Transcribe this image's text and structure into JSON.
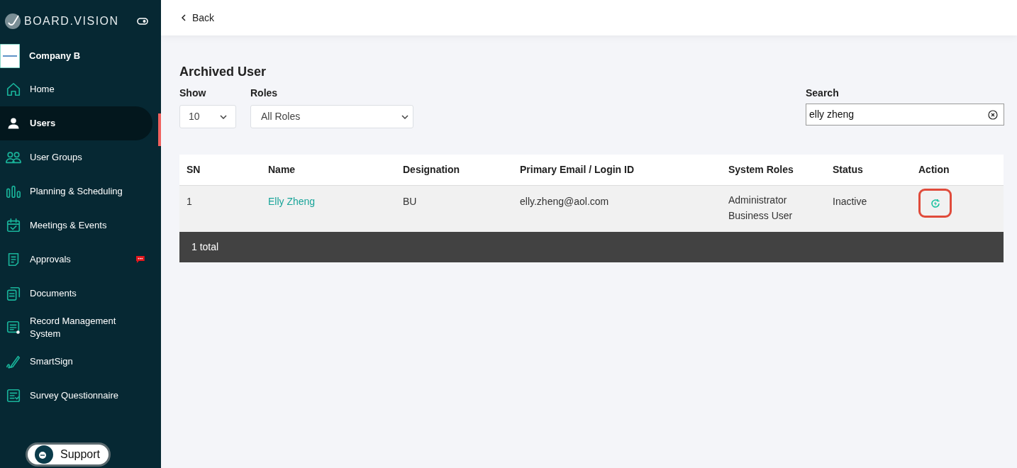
{
  "sidebar": {
    "brand": "BOARD.VISION",
    "company": {
      "name": "Company B"
    },
    "items": [
      {
        "label": "Home",
        "selected": false
      },
      {
        "label": "Users",
        "selected": true
      },
      {
        "label": "User Groups",
        "selected": false
      },
      {
        "label": "Planning & Scheduling",
        "selected": false
      },
      {
        "label": "Meetings & Events",
        "selected": false
      },
      {
        "label": "Approvals",
        "selected": false,
        "badge": true
      },
      {
        "label": "Documents",
        "selected": false
      },
      {
        "label": "Record Management System",
        "selected": false
      },
      {
        "label": "SmartSign",
        "selected": false
      },
      {
        "label": "Survey Questionnaire",
        "selected": false
      }
    ],
    "support": "Support"
  },
  "topbar": {
    "back": "Back"
  },
  "page": {
    "title": "Archived User",
    "show": {
      "label": "Show",
      "value": "10"
    },
    "roles": {
      "label": "Roles",
      "value": "All Roles"
    },
    "search": {
      "label": "Search",
      "value": "elly zheng"
    }
  },
  "table": {
    "columns": [
      "SN",
      "Name",
      "Designation",
      "Primary Email / Login ID",
      "System Roles",
      "Status",
      "Action"
    ],
    "rows": [
      {
        "sn": "1",
        "name": "Elly Zheng",
        "designation": "BU",
        "email": "elly.zheng@aol.com",
        "roles": [
          "Administrator",
          "Business User"
        ],
        "status": "Inactive"
      }
    ],
    "footer": "1 total"
  }
}
